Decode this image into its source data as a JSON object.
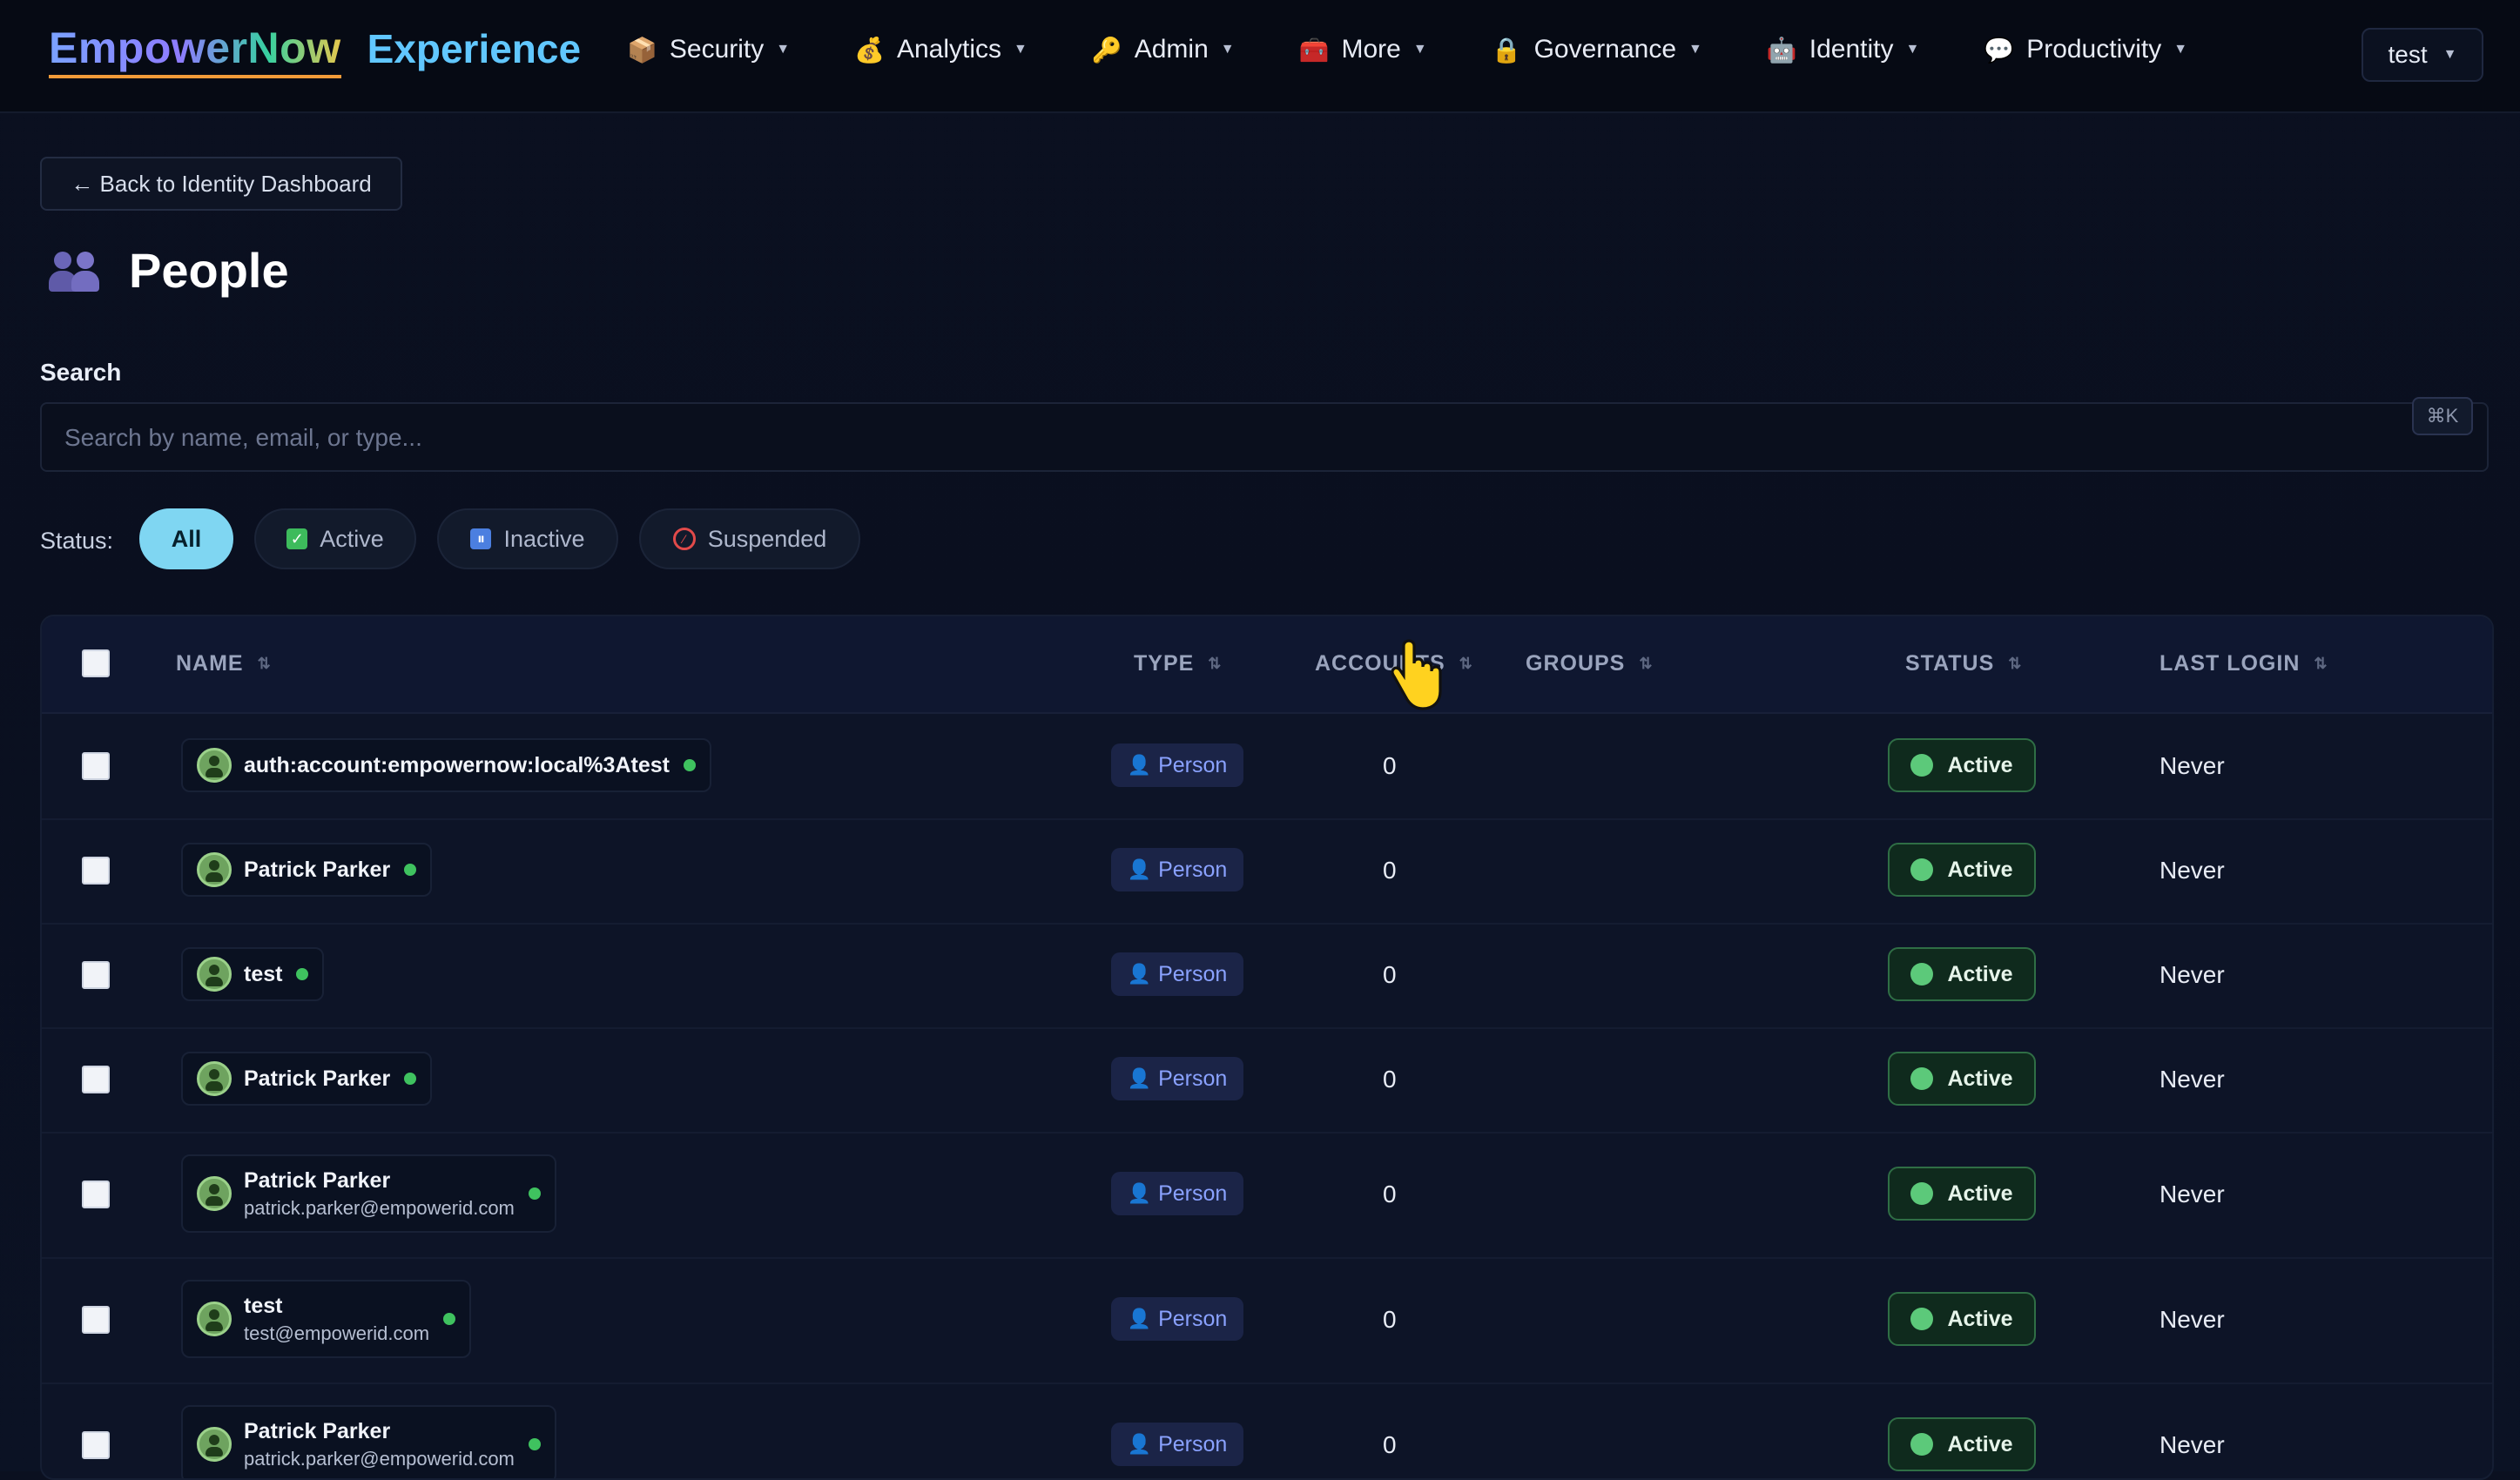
{
  "app": {
    "brand": "EmpowerNow",
    "product": "Experience"
  },
  "nav": [
    {
      "label": "Security",
      "icon": "shield-box-icon",
      "glyph": "📦"
    },
    {
      "label": "Analytics",
      "icon": "money-bag-icon",
      "glyph": "💰"
    },
    {
      "label": "Admin",
      "icon": "key-icon",
      "glyph": "🔑"
    },
    {
      "label": "More",
      "icon": "toolbox-icon",
      "glyph": "🧰"
    },
    {
      "label": "Governance",
      "icon": "lock-icon",
      "glyph": "🔒"
    },
    {
      "label": "Identity",
      "icon": "robot-icon",
      "glyph": "🤖"
    },
    {
      "label": "Productivity",
      "icon": "speech-bubble-icon",
      "glyph": "💬"
    }
  ],
  "user": {
    "name": "test"
  },
  "back_button": "← Back to Identity Dashboard",
  "page": {
    "title": "People"
  },
  "search": {
    "label": "Search",
    "placeholder": "Search by name, email, or type...",
    "shortcut": "⌘K"
  },
  "status_filter": {
    "label": "Status:",
    "options": [
      {
        "label": "All",
        "selected": true
      },
      {
        "label": "Active",
        "icon": "checkmark-icon",
        "color": "#3dbb5c"
      },
      {
        "label": "Inactive",
        "icon": "pause-icon",
        "color": "#4b7fe0"
      },
      {
        "label": "Suspended",
        "icon": "prohibited-icon",
        "color": "#e24a4a"
      }
    ]
  },
  "table": {
    "columns": [
      "NAME",
      "TYPE",
      "ACCOUNTS",
      "GROUPS",
      "STATUS",
      "LAST LOGIN"
    ],
    "rows": [
      {
        "name": "auth:account:empowernow:local%3Atest",
        "email": "",
        "type": "Person",
        "accounts": "0",
        "groups": "",
        "status": "Active",
        "last_login": "Never"
      },
      {
        "name": "Patrick Parker",
        "email": "",
        "type": "Person",
        "accounts": "0",
        "groups": "",
        "status": "Active",
        "last_login": "Never"
      },
      {
        "name": "test",
        "email": "",
        "type": "Person",
        "accounts": "0",
        "groups": "",
        "status": "Active",
        "last_login": "Never"
      },
      {
        "name": "Patrick Parker",
        "email": "",
        "type": "Person",
        "accounts": "0",
        "groups": "",
        "status": "Active",
        "last_login": "Never"
      },
      {
        "name": "Patrick Parker",
        "email": "patrick.parker@empowerid.com",
        "type": "Person",
        "accounts": "0",
        "groups": "",
        "status": "Active",
        "last_login": "Never"
      },
      {
        "name": "test",
        "email": "test@empowerid.com",
        "type": "Person",
        "accounts": "0",
        "groups": "",
        "status": "Active",
        "last_login": "Never"
      },
      {
        "name": "Patrick Parker",
        "email": "patrick.parker@empowerid.com",
        "type": "Person",
        "accounts": "0",
        "groups": "",
        "status": "Active",
        "last_login": "Never"
      }
    ]
  },
  "colors": {
    "accent": "#7fd6f2",
    "active_green": "#5cc97a",
    "type_text": "#8aa2ff",
    "background": "#0b1020"
  }
}
